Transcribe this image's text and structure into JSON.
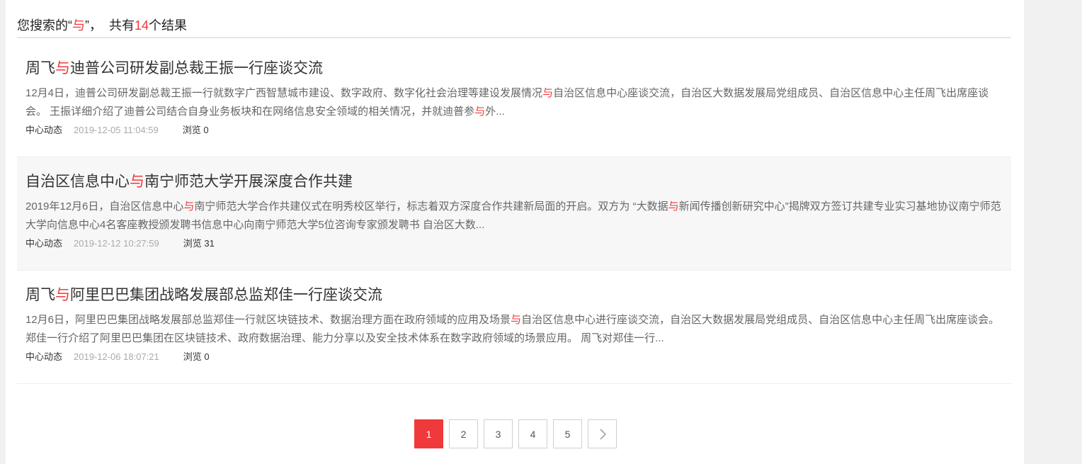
{
  "header": {
    "prefix": "您搜索的“",
    "keyword": "与",
    "mid": "”，  共有",
    "count": "14",
    "suffix": "个结果"
  },
  "results": [
    {
      "title": [
        "周飞",
        "与",
        "迪普公司研发副总裁王振一行座谈交流"
      ],
      "desc": [
        "12月4日，迪普公司研发副总裁王振一行就数字广西智慧城市建设、数字政府、数字化社会治理等建设发展情况",
        "与",
        "自治区信息中心座谈交流，自治区大数据发展局党组成员、自治区信息中心主任周飞出席座谈会。 王振详细介绍了迪普公司结合自身业务板块和在网络信息安全领域的相关情况，并就迪普参",
        "与",
        "外..."
      ],
      "category": "中心动态",
      "date": "2019-12-05 11:04:59",
      "views": "浏览 0"
    },
    {
      "title": [
        "自治区信息中心",
        "与",
        "南宁师范大学开展深度合作共建"
      ],
      "desc": [
        "2019年12月6日，自治区信息中心",
        "与",
        "南宁师范大学合作共建仪式在明秀校区举行，标志着双方深度合作共建新局面的开启。双方为 “大数据",
        "与",
        "新闻传播创新研究中心”揭牌双方签订共建专业实习基地协议南宁师范大学向信息中心4名客座教授颁发聘书信息中心向南宁师范大学5位咨询专家颁发聘书 自治区大数..."
      ],
      "category": "中心动态",
      "date": "2019-12-12 10:27:59",
      "views": "浏览 31"
    },
    {
      "title": [
        "周飞",
        "与",
        "阿里巴巴集团战略发展部总监郑佳一行座谈交流"
      ],
      "desc": [
        "12月6日，阿里巴巴集团战略发展部总监郑佳一行就区块链技术、数据治理方面在政府领域的应用及场景",
        "与",
        "自治区信息中心进行座谈交流，自治区大数据发展局党组成员、自治区信息中心主任周飞出席座谈会。 郑佳一行介绍了阿里巴巴集团在区块链技术、政府数据治理、能力分享以及安全技术体系在数字政府领域的场景应用。 周飞对郑佳一行..."
      ],
      "category": "中心动态",
      "date": "2019-12-06 18:07:21",
      "views": "浏览 0"
    }
  ],
  "pagination": {
    "pages": [
      "1",
      "2",
      "3",
      "4",
      "5"
    ],
    "current": "1",
    "next": "›"
  },
  "colors": {
    "accent": "#f0393a"
  }
}
